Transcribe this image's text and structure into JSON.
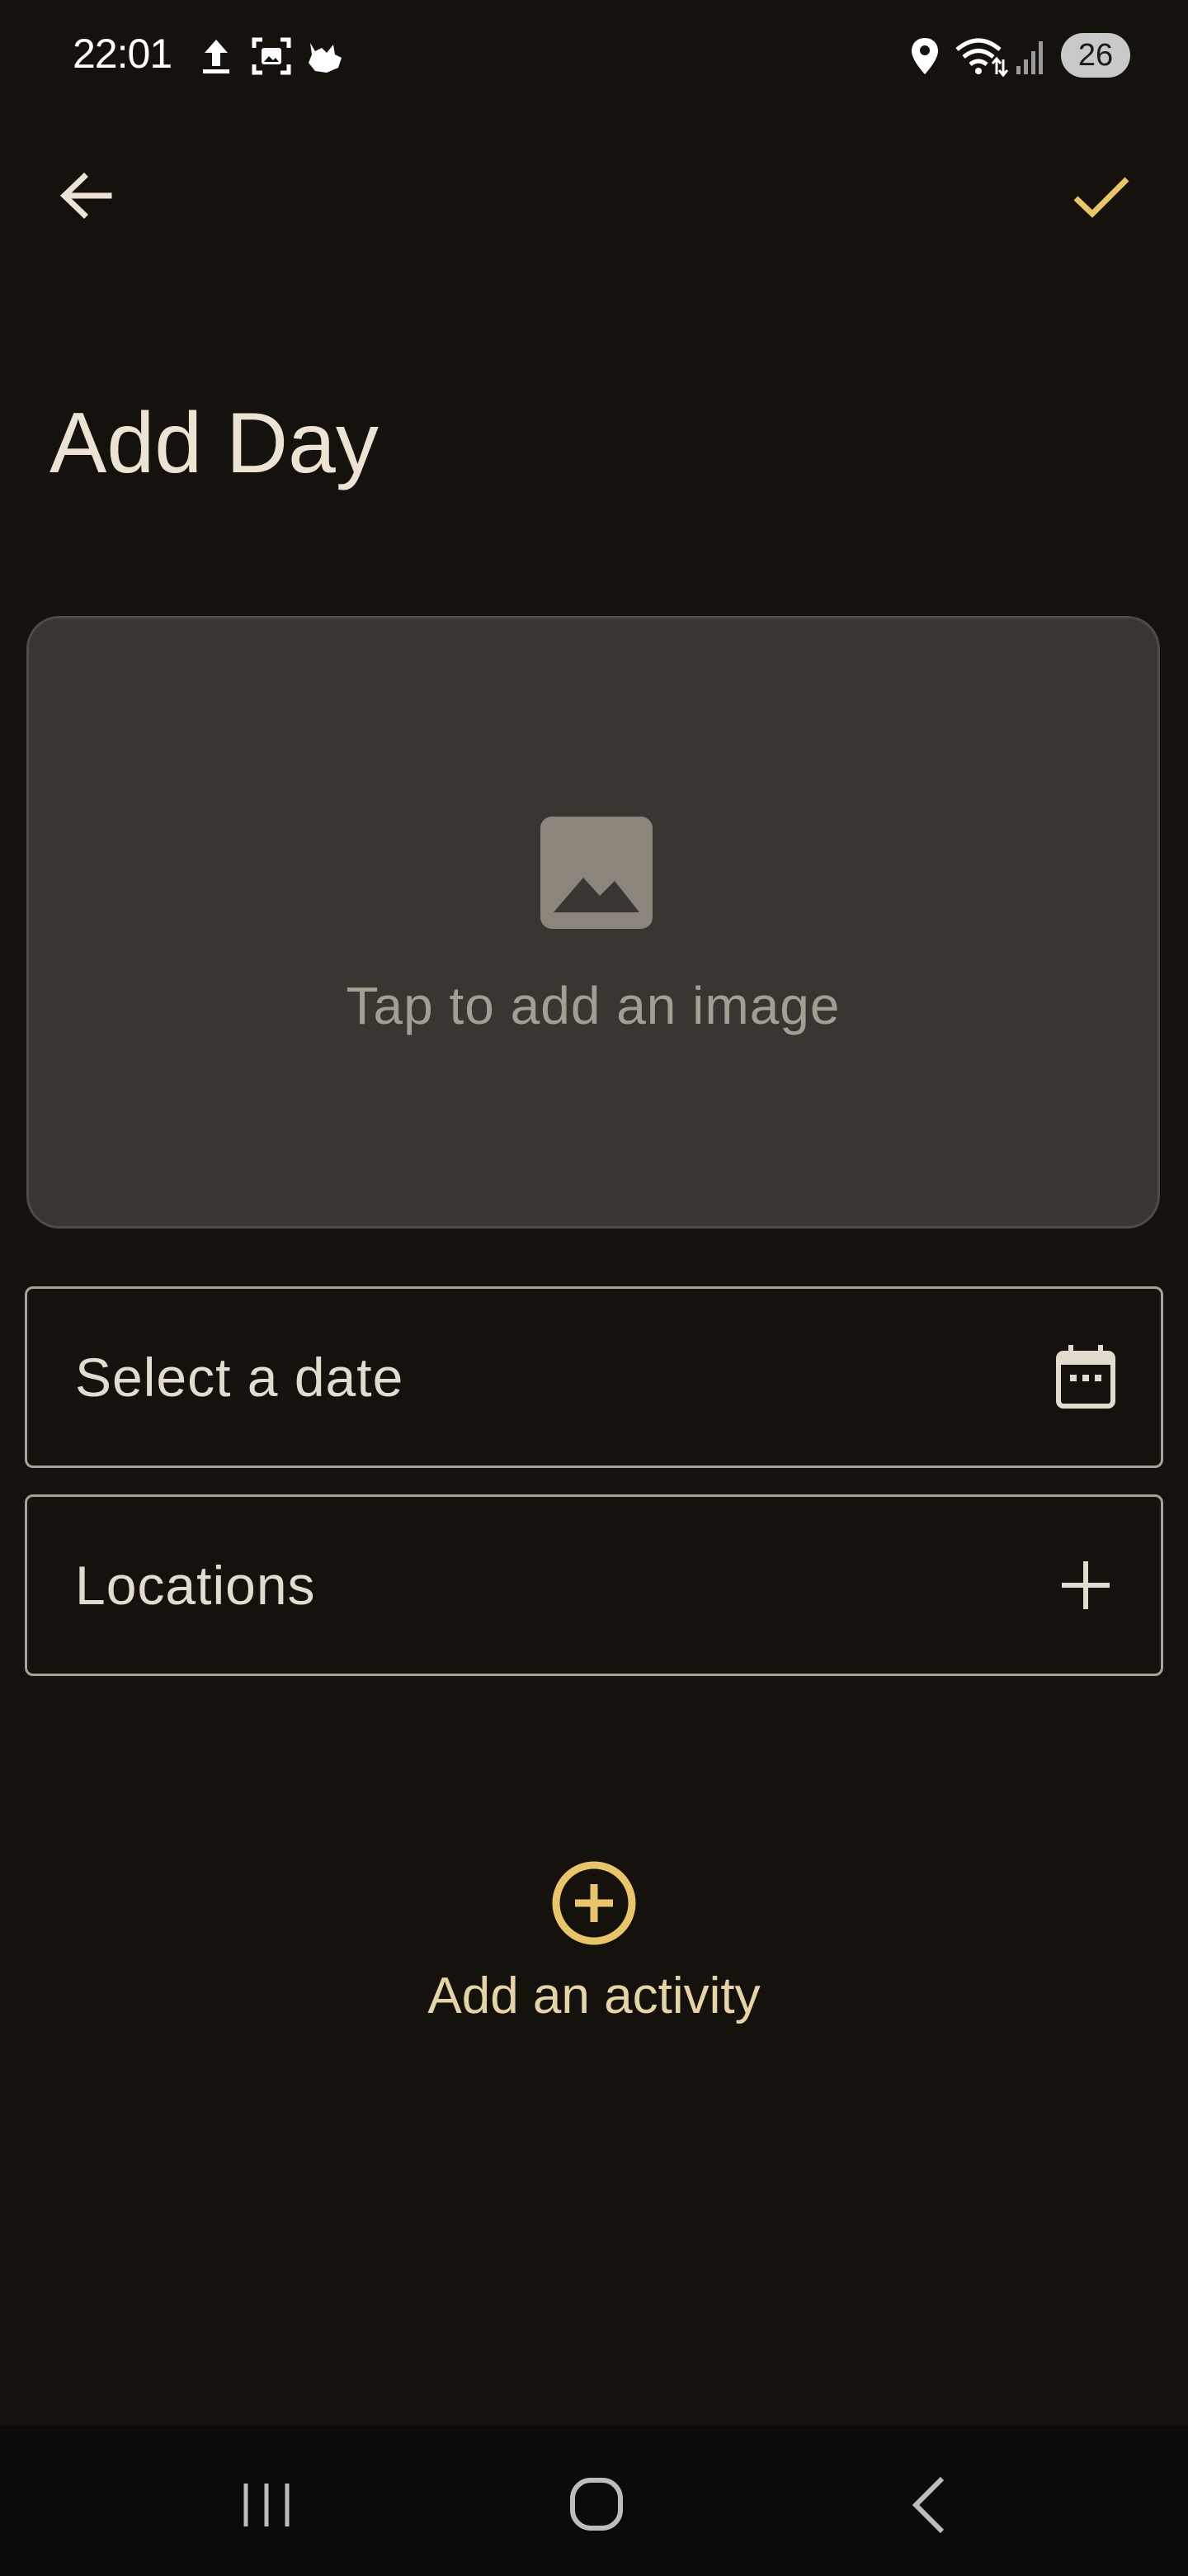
{
  "status_bar": {
    "time": "22:01",
    "battery": "26",
    "icons": [
      "upload-icon",
      "screenshot-icon",
      "cat-icon",
      "location-icon",
      "wifi-icon",
      "signal-icon"
    ]
  },
  "app_bar": {
    "back_icon": "arrow-back-icon",
    "confirm_icon": "check-icon"
  },
  "page": {
    "title": "Add Day"
  },
  "image_picker": {
    "label": "Tap to add an image",
    "icon": "image-icon"
  },
  "fields": {
    "date": {
      "label": "Select a date",
      "icon": "calendar-icon"
    },
    "locations": {
      "label": "Locations",
      "icon": "plus-icon"
    }
  },
  "add_activity": {
    "label": "Add an activity",
    "icon": "add-circle-icon"
  },
  "nav_bar": {
    "buttons": [
      "recents-icon",
      "home-icon",
      "back-nav-icon"
    ]
  },
  "colors": {
    "background": "#15120e",
    "accent": "#e8c46a",
    "card": "#393530",
    "text": "#e9e1d3"
  }
}
